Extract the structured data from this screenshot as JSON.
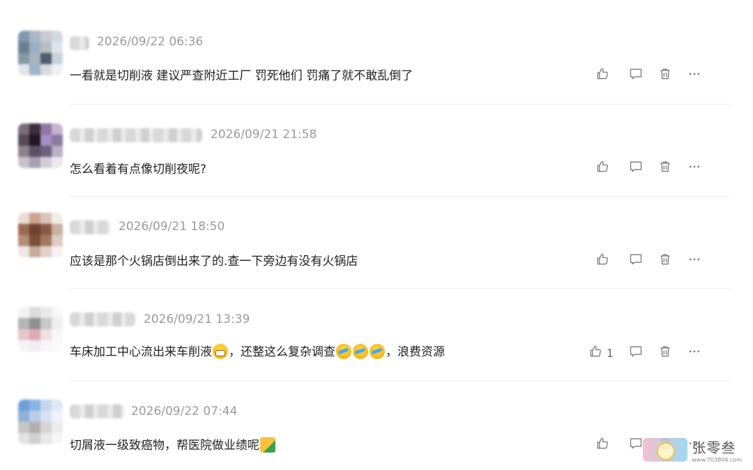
{
  "comments": [
    {
      "time": "2026/09/22 06:36",
      "text": "一看就是切削液 建议严查附近工厂 罚死他们 罚痛了就不敢乱倒了",
      "likes": "",
      "avatar_colors": [
        "#7f97ae",
        "#aab7c6",
        "#c9c9cf",
        "#cfd7df",
        "#6c7e90",
        "#9aaec4",
        "#b7bcc0",
        "#dfe4ea",
        "#8797a8",
        "#a9b4bf",
        "#4d5d6b",
        "#c8d0d8",
        "#e1e6ea",
        "#9fb2c5",
        "#d6dbe0",
        "#eef1f4"
      ]
    },
    {
      "time": "2026/09/21 21:58",
      "text": "怎么看着有点像切削夜呢?",
      "likes": "",
      "avatar_colors": [
        "#7c6c7b",
        "#3d2f3c",
        "#8e78a0",
        "#c9b4d0",
        "#574a58",
        "#1f1a24",
        "#a58fc5",
        "#8c7aa0",
        "#8a8090",
        "#5c5166",
        "#6d5f7c",
        "#b9b0c3",
        "#c7c0c9",
        "#a99fb2",
        "#d2ccd6",
        "#ebe7ee"
      ]
    },
    {
      "time": "2026/09/21 18:50",
      "text": "应该是那个火锅店倒出来了的.查一下旁边有没有火锅店",
      "likes": "",
      "avatar_colors": [
        "#e8dcd6",
        "#c9a690",
        "#d9c4b8",
        "#f1ebe8",
        "#9c6a52",
        "#6d4433",
        "#8b5a44",
        "#c9b0a1",
        "#b38d79",
        "#7a4f3c",
        "#a47761",
        "#dcccc2",
        "#efe6e1",
        "#c7ab9b",
        "#e0d2ca",
        "#f6f1ee"
      ]
    },
    {
      "time": "2026/09/21 13:39",
      "text_before": "车床加工中心流出来车削液",
      "text_middle": "，还整这么复杂调查",
      "text_after": "，浪费资源",
      "likes": "1",
      "avatar_colors": [
        "#f2f2f2",
        "#dcdcdc",
        "#e8e8e8",
        "#f7f7f7",
        "#b5b5b5",
        "#8f8f8f",
        "#c7c7c7",
        "#eeeeee",
        "#e7c5cc",
        "#dca9b4",
        "#f0dfe3",
        "#f7f7f7",
        "#f4f4f4",
        "#eeeeee",
        "#f6f6f6",
        "#fafafa"
      ]
    },
    {
      "time": "2026/09/22 07:44",
      "text": "切屑液一级致癌物，帮医院做业绩呢",
      "likes": "",
      "avatar_colors": [
        "#6f9fd8",
        "#8ab3e2",
        "#c3d6ee",
        "#dfe9f5",
        "#8fb0d8",
        "#b9cde8",
        "#d6e2f1",
        "#eef3f9",
        "#c7c7c7",
        "#b0b0b0",
        "#d4d4d4",
        "#ebebeb",
        "#e2e2e2",
        "#d0d0d0",
        "#e8e8e8",
        "#f5f5f5"
      ]
    }
  ],
  "icons": {
    "like": "thumbs-up-icon",
    "reply": "comment-icon",
    "delete": "trash-icon",
    "more": "more-icon"
  },
  "watermark": {
    "title": "张零叁",
    "url": "www.703804.com"
  }
}
